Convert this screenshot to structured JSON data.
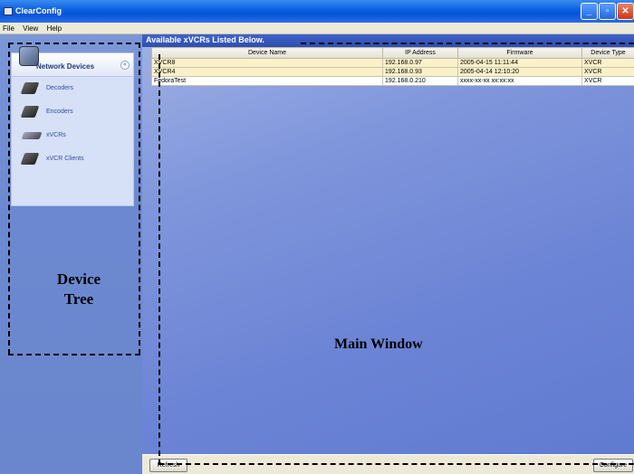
{
  "window": {
    "title": "ClearConfig",
    "minimize_glyph": "_",
    "maximize_glyph": "▫",
    "close_glyph": "✕"
  },
  "menu": [
    "File",
    "View",
    "Help"
  ],
  "sidebar": {
    "header_label": "Network Devices",
    "collapse_glyph": "«",
    "items": [
      {
        "label": "Decoders",
        "icon": "decoder-icon"
      },
      {
        "label": "Encoders",
        "icon": "encoder-icon"
      },
      {
        "label": "xVCRs",
        "icon": "xvcr-icon"
      },
      {
        "label": "xVCR Clients",
        "icon": "xvcr-client-icon"
      }
    ],
    "annotation_line1": "Device",
    "annotation_line2": "Tree"
  },
  "main": {
    "header": "Available xVCRs Listed Below.",
    "columns": [
      "Device Name",
      "IP Address",
      "Firmware",
      "Device Type"
    ],
    "rows": [
      {
        "name": "XVCR8",
        "ip": "192.168.0.97",
        "firmware": "2005-04-15 11:11:44",
        "type": "XVCR"
      },
      {
        "name": "XVCR4",
        "ip": "192.168.0.93",
        "firmware": "2005-04-14 12:10:20",
        "type": "XVCR"
      },
      {
        "name": "FedoraTest",
        "ip": "192.168.0.210",
        "firmware": "xxxx-xx-xx xx:xx:xx",
        "type": "XVCR"
      }
    ],
    "annotation": "Main Window"
  },
  "footer": {
    "refresh_label": "Refresh",
    "configure_label": "Configure"
  },
  "colors": {
    "titlebar": "#0553d6",
    "sidebar": "#6c88d0",
    "main_header": "#2d4fb4",
    "selected_row": "#fbf1c8"
  }
}
